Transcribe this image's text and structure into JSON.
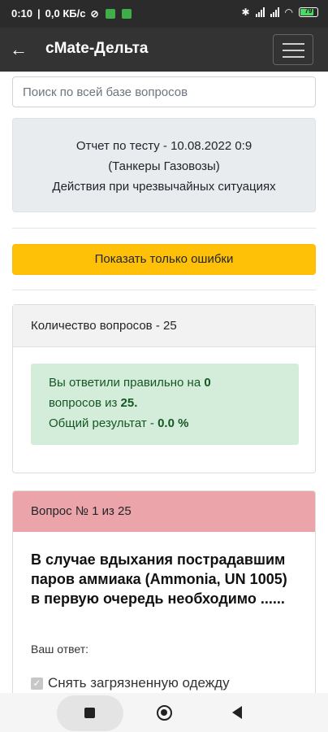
{
  "status_bar": {
    "time": "0:10",
    "network_speed": "0,0 КБ/с",
    "battery_level": "79",
    "icons": [
      "wifi-slash-icon",
      "app-notification-icon",
      "app-notification-icon",
      "bluetooth-icon",
      "signal-icon",
      "signal-icon",
      "wifi-icon",
      "battery-icon"
    ]
  },
  "app_bar": {
    "title": "cMate-Дельта",
    "back_icon": "arrow-left-icon",
    "menu_icon": "hamburger-menu-icon"
  },
  "search": {
    "placeholder": "Поиск по всей базе вопросов",
    "value": ""
  },
  "report": {
    "line1": "Отчет по тесту - 10.08.2022 0:9",
    "line2": "(Танкеры Газовозы)",
    "line3": "Действия при чрезвычайных ситуациях"
  },
  "show_errors_button": "Показать только ошибки",
  "summary": {
    "header": "Количество вопросов - 25",
    "p1": "Вы ответили правильно на",
    "correct": "0",
    "p2": "вопросов из",
    "total": "25.",
    "p3": "Общий результат -",
    "percent": "0.0 %"
  },
  "question": {
    "header": "Вопрос № 1 из 25",
    "text": "В случае вдыхания пострадавшим паров аммиака (Ammonia, UN 1005) в первую очередь необходимо ......",
    "your_answer_label": "Ваш ответ:",
    "answer_option": "Снять загрязненную одежду"
  },
  "colors": {
    "app_bar": "#333333",
    "accent_button": "#ffc107",
    "success_bg": "#d4edda",
    "wrong_header": "#eba4a9"
  }
}
